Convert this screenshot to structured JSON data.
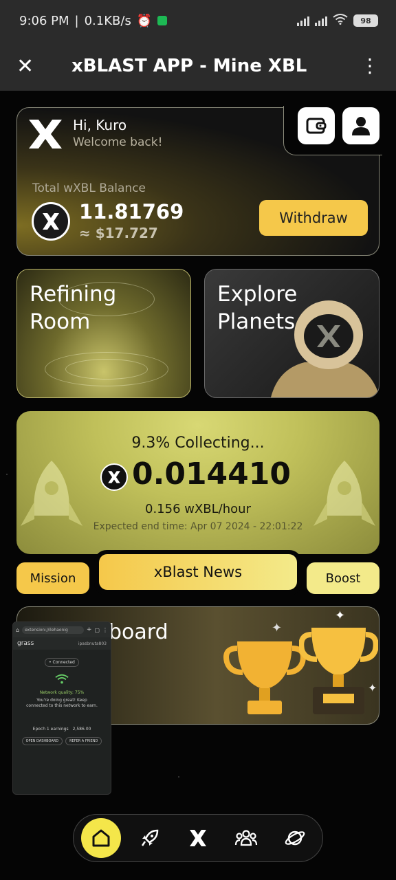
{
  "status_bar": {
    "time": "9:06 PM",
    "speed": "0.1KB/s",
    "battery": "98"
  },
  "app_bar": {
    "title": "xBLAST APP - Mine XBL"
  },
  "header": {
    "greeting": "Hi, Kuro",
    "subtitle": "Welcome back!"
  },
  "balance": {
    "label": "Total wXBL Balance",
    "amount": "11.81769",
    "usd": "≈ $17.727",
    "withdraw_label": "Withdraw"
  },
  "tiles": {
    "refining": "Refining\nRoom",
    "explore": "Explore\nPlanets"
  },
  "collecting": {
    "status": "9.3% Collecting...",
    "amount": "0.014410",
    "rate": "0.156 wXBL/hour",
    "expected_end": "Expected end time: Apr 07 2024 - 22:01:22"
  },
  "actions": {
    "mission": "Mission",
    "news": "xBlast News",
    "boost": "Boost"
  },
  "leaderboard": {
    "label": "board"
  },
  "overlay": {
    "url": "extension://ilehaonig",
    "app": "grass",
    "account": "ipasbnuta803",
    "connected": "• Connected",
    "quality": "Network quality: 75%",
    "message": "You're doing great! Keep connected to this network to earn.",
    "epoch": "Epoch 1 earnings",
    "epoch_value": "2,586.00",
    "btn_dashboard": "OPEN DASHBOARD",
    "btn_friend": "REFER A FRIEND"
  },
  "nav": {
    "items": [
      "home-icon",
      "rocket-icon",
      "x-icon",
      "people-icon",
      "planet-icon"
    ],
    "active": "home-icon"
  },
  "colors": {
    "accent_yellow": "#f5c84a",
    "nav_active": "#f4e64a",
    "card_olive": "#c0c05a"
  }
}
